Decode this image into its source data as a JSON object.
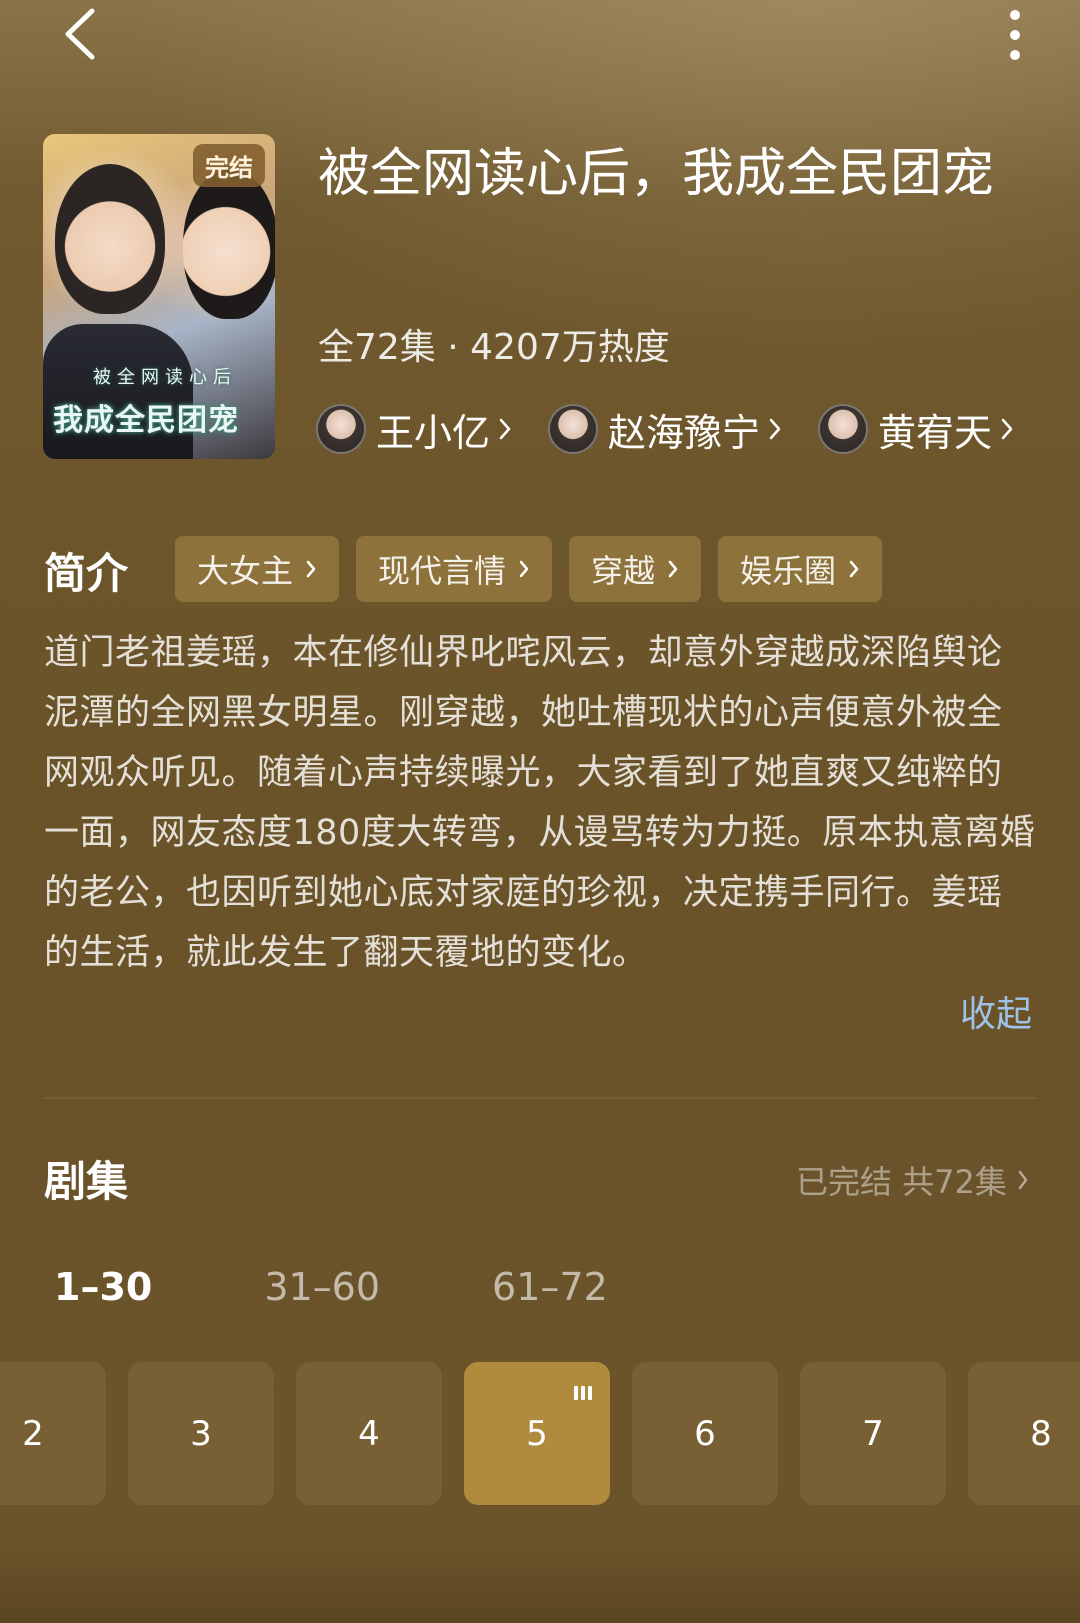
{
  "nav": {
    "back_icon": "chevron-left-icon",
    "more_icon": "more-vertical-icon"
  },
  "drama": {
    "poster_badge": "完结",
    "poster_title": "我成全民团宠",
    "poster_subtitle": "被全网读心后",
    "title": "被全网读心后，我成全民团宠",
    "meta": "全72集 · 4207万热度",
    "actors": [
      {
        "name": "王小亿"
      },
      {
        "name": "赵海豫宁"
      },
      {
        "name": "黄宥天"
      }
    ]
  },
  "intro": {
    "label": "简介",
    "tags": [
      "大女主",
      "现代言情",
      "穿越",
      "娱乐圈"
    ],
    "description": "道门老祖姜瑶，本在修仙界叱咤风云，却意外穿越成深陷舆论泥潭的全网黑女明星。刚穿越，她吐槽现状的心声便意外被全网观众听见。随着心声持续曝光，大家看到了她直爽又纯粹的一面，网友态度180度大转弯，从谩骂转为力挺。原本执意离婚的老公，也因听到她心底对家庭的珍视，决定携手同行。姜瑶的生活，就此发生了翻天覆地的变化。",
    "collapse_label": "收起"
  },
  "episodes": {
    "label": "剧集",
    "status": "已完结 共72集",
    "ranges": [
      "1–30",
      "31–60",
      "61–72"
    ],
    "active_range": "1–30",
    "items": [
      "2",
      "3",
      "4",
      "5",
      "6",
      "7",
      "8"
    ],
    "current": "5"
  },
  "colors": {
    "background": "#6b532a",
    "accent_current_episode": "#b08a3d",
    "link": "#9fc2e8"
  }
}
